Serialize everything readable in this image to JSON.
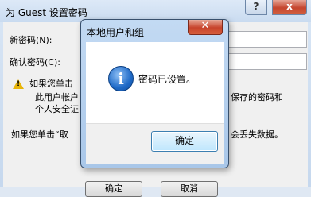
{
  "background_window": {
    "title": "为 Guest 设置密码",
    "help_label": "?",
    "close_label": "x",
    "new_password_label": "新密码(N):",
    "confirm_password_label": "确认密码(C):",
    "warning_line1": "如果您单击",
    "warning_line2": "此用户帐户",
    "warning_line2_tail": "保存的密码和",
    "warning_line3": "个人安全证",
    "bottom_text": "如果您单击“取",
    "bottom_text_tail": "会丢失数据。",
    "ok_label": "确定",
    "cancel_label": "取消"
  },
  "dialog": {
    "title": "本地用户和组",
    "close_label": "✕",
    "icon": "info-icon",
    "icon_glyph": "i",
    "message": "密码已设置。",
    "ok_label": "确定"
  }
}
